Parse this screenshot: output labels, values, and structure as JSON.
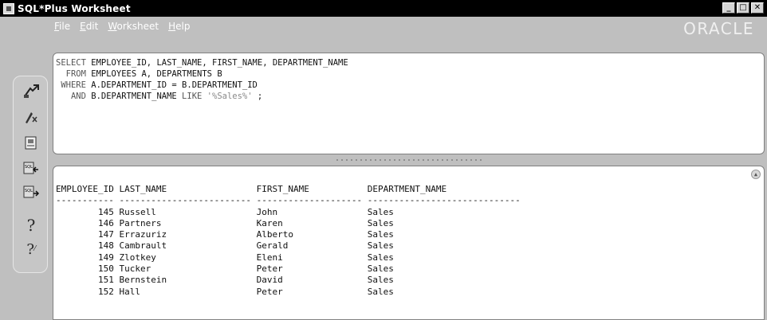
{
  "window": {
    "title": "SQL*Plus Worksheet"
  },
  "menu": [
    {
      "label": "File",
      "mnemonic": "F"
    },
    {
      "label": "Edit",
      "mnemonic": "E"
    },
    {
      "label": "Worksheet",
      "mnemonic": "W"
    },
    {
      "label": "Help",
      "mnemonic": "H"
    }
  ],
  "logo": "ORACLE",
  "toolbar": {
    "icons": [
      "connect-icon",
      "execute-icon",
      "script-icon",
      "previous-command-icon",
      "next-command-icon",
      "help-icon",
      "context-help-icon"
    ]
  },
  "editor": {
    "lines": [
      "SELECT EMPLOYEE_ID, LAST_NAME, FIRST_NAME, DEPARTMENT_NAME",
      "  FROM EMPLOYEES A, DEPARTMENTS B",
      " WHERE A.DEPARTMENT_ID = B.DEPARTMENT_ID",
      "   AND B.DEPARTMENT_NAME LIKE '%Sales%' ;"
    ]
  },
  "results": {
    "columns": [
      "EMPLOYEE_ID",
      "LAST_NAME",
      "FIRST_NAME",
      "DEPARTMENT_NAME"
    ],
    "rows": [
      [
        "145",
        "Russell",
        "John",
        "Sales"
      ],
      [
        "146",
        "Partners",
        "Karen",
        "Sales"
      ],
      [
        "147",
        "Errazuriz",
        "Alberto",
        "Sales"
      ],
      [
        "148",
        "Cambrault",
        "Gerald",
        "Sales"
      ],
      [
        "149",
        "Zlotkey",
        "Eleni",
        "Sales"
      ],
      [
        "150",
        "Tucker",
        "Peter",
        "Sales"
      ],
      [
        "151",
        "Bernstein",
        "David",
        "Sales"
      ],
      [
        "152",
        "Hall",
        "Peter",
        "Sales"
      ]
    ]
  },
  "colors": {
    "titlebar": "#000000",
    "background": "#bfbfbf",
    "editor": "#ffffff"
  }
}
